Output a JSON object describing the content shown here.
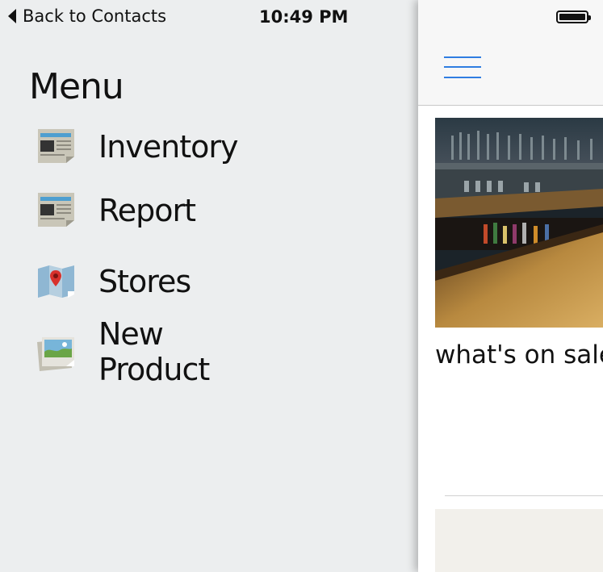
{
  "status_bar": {
    "back_label": "Back to Contacts",
    "time": "10:49 PM"
  },
  "menu": {
    "title": "Menu",
    "items": [
      {
        "label": "Inventory",
        "icon": "newspaper-icon"
      },
      {
        "label": "Report",
        "icon": "newspaper-icon"
      },
      {
        "label": "Stores",
        "icon": "map-pin-icon"
      },
      {
        "label": "New Product",
        "icon": "photo-icon"
      }
    ]
  },
  "content": {
    "card_title": "what's on sale"
  },
  "colors": {
    "accent": "#2f7de1",
    "menu_background": "#eceeef"
  }
}
